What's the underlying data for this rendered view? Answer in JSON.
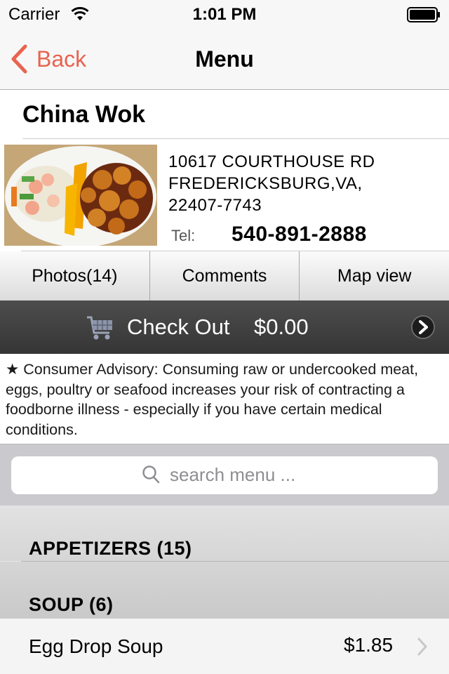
{
  "status_bar": {
    "carrier": "Carrier",
    "time": "1:01 PM"
  },
  "nav": {
    "back_label": "Back",
    "title": "Menu"
  },
  "restaurant": {
    "name": "China Wok",
    "address_line1": "10617 COURTHOUSE RD",
    "address_line2": "FREDERICKSBURG,VA,",
    "address_line3": "22407-7743",
    "tel_label": "Tel:",
    "tel": "540-891-2888"
  },
  "tabs": [
    {
      "label": "Photos(14)"
    },
    {
      "label": "Comments"
    },
    {
      "label": "Map view"
    }
  ],
  "checkout": {
    "label": "Check Out",
    "amount": "$0.00"
  },
  "advisory": "★ Consumer Advisory: Consuming raw or undercooked meat, eggs, poultry or seafood increases your risk of contracting a foodborne illness - especially if you have certain medical conditions.",
  "search": {
    "placeholder": "search menu ..."
  },
  "menu": {
    "sections": [
      {
        "label": "APPETIZERS (15)"
      },
      {
        "label": "SOUP (6)"
      }
    ],
    "items": [
      {
        "name": "Egg Drop Soup",
        "price": "$1.85"
      }
    ]
  },
  "colors": {
    "accent": "#e8634f",
    "checkout_bar": "#3e3e3e",
    "search_bg": "#c9c9ce"
  },
  "icons": {
    "wifi": "wifi-icon",
    "battery": "battery-icon",
    "back": "chevron-left-icon",
    "cart": "cart-icon",
    "checkout_go": "chevron-right-circle-icon",
    "search": "search-icon",
    "disclosure": "chevron-right-icon"
  }
}
